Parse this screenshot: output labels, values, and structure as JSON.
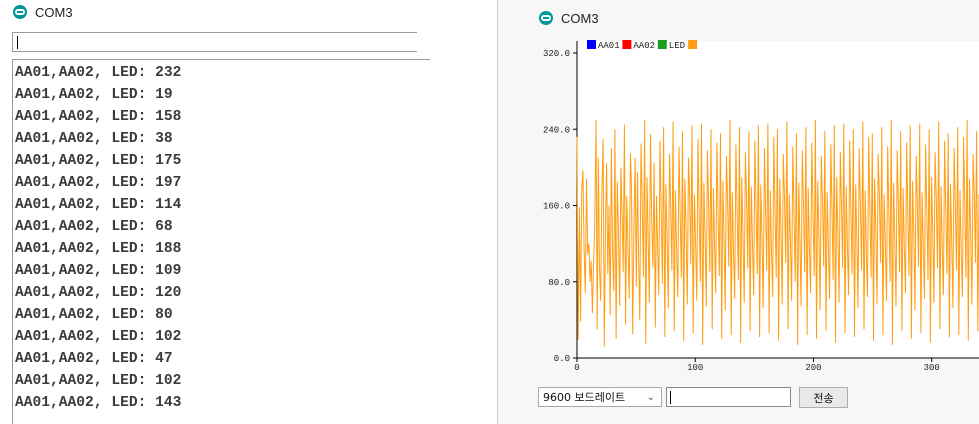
{
  "monitor": {
    "title": "COM3",
    "input_value": "",
    "lines": [
      "AA01,AA02, LED: 232",
      "AA01,AA02, LED: 19",
      "AA01,AA02, LED: 158",
      "AA01,AA02, LED: 38",
      "AA01,AA02, LED: 175",
      "AA01,AA02, LED: 197",
      "AA01,AA02, LED: 114",
      "AA01,AA02, LED: 68",
      "AA01,AA02, LED: 188",
      "AA01,AA02, LED: 109",
      "AA01,AA02, LED: 120",
      "AA01,AA02, LED: 80",
      "AA01,AA02, LED: 102",
      "AA01,AA02, LED: 47",
      "AA01,AA02, LED: 102",
      "AA01,AA02, LED: 143"
    ]
  },
  "plotter": {
    "title": "COM3",
    "baud_label": "9600 보드레이트",
    "input_value": "",
    "send_label": "전송",
    "icon_app": "arduino-icon",
    "icon_chevron": "chevron-down-icon"
  },
  "chart_data": {
    "type": "line",
    "ylim": [
      0,
      320
    ],
    "xlim": [
      0,
      340
    ],
    "y_ticks": [
      "0.0",
      "80.0",
      "160.0",
      "240.0",
      "320.0"
    ],
    "x_ticks": [
      "0",
      "100",
      "200",
      "300"
    ],
    "legend_placement": "top-left",
    "legend": [
      {
        "name": "AA01",
        "color": "#0000ff"
      },
      {
        "name": "AA02",
        "color": "#ff0000"
      },
      {
        "name": "LED",
        "color": "#1c9c1c"
      },
      {
        "name": "",
        "color": "#ff9e14"
      }
    ],
    "series": [
      {
        "name": "",
        "color": "#ff9e14",
        "values": [
          232,
          19,
          158,
          38,
          175,
          197,
          114,
          68,
          188,
          109,
          120,
          80,
          102,
          47,
          102,
          143,
          250,
          30,
          210,
          95,
          60,
          175,
          230,
          12,
          140,
          205,
          88,
          160,
          45,
          220,
          110,
          70,
          240,
          20,
          185,
          130,
          55,
          200,
          150,
          90,
          245,
          35,
          170,
          115,
          62,
          215,
          180,
          25,
          135,
          210,
          75,
          195,
          100,
          40,
          225,
          165,
          85,
          250,
          15,
          190,
          125,
          58,
          235,
          145,
          95,
          205,
          32,
          170,
          118,
          66,
          228,
          155,
          78,
          242,
          22,
          182,
          128,
          52,
          214,
          160,
          92,
          248,
          28,
          176,
          112,
          64,
          222,
          150,
          84,
          238,
          18,
          188,
          132,
          56,
          210,
          168,
          98,
          244,
          26,
          172,
          120,
          60,
          230,
          158,
          80,
          246,
          14,
          184,
          126,
          54,
          218,
          162,
          90,
          240,
          30,
          178,
          116,
          68,
          226,
          152,
          86,
          236,
          20,
          186,
          130,
          50,
          212,
          164,
          96,
          250,
          24,
          174,
          114,
          62,
          224,
          156,
          82,
          242,
          16,
          190,
          128,
          58,
          216,
          166,
          94,
          238,
          28,
          180,
          118,
          66,
          228,
          154,
          88,
          244,
          22,
          182,
          124,
          52,
          220,
          160,
          92,
          246,
          26,
          176,
          112,
          64,
          232,
          158,
          84,
          240,
          18,
          188,
          134,
          56,
          214,
          170,
          100,
          248,
          30,
          172,
          120,
          60,
          222,
          150,
          80,
          236,
          14,
          184,
          126,
          54,
          218,
          162,
          90,
          242,
          24,
          178,
          116,
          68,
          226,
          152,
          86,
          250,
          20,
          186,
          130,
          50,
          212,
          164,
          96,
          238,
          28,
          174,
          114,
          62,
          224,
          156,
          82,
          244,
          16,
          190,
          128,
          58,
          216,
          166,
          94,
          246,
          26,
          180,
          118,
          66,
          228,
          154,
          88,
          240,
          22,
          182,
          124,
          52,
          220,
          160,
          92,
          248,
          30,
          176,
          112,
          64,
          232,
          158,
          84,
          236,
          18,
          188,
          134,
          56,
          214,
          170,
          100,
          242,
          24,
          172,
          120,
          60,
          222,
          150,
          80,
          250,
          14,
          184,
          126,
          54,
          218,
          162,
          90,
          238,
          28,
          178,
          116,
          68,
          226,
          152,
          86,
          244,
          20,
          186,
          130,
          50,
          212,
          164,
          96,
          246,
          26,
          174,
          114,
          62,
          224,
          156,
          82,
          240,
          16,
          190,
          128,
          58,
          216,
          166,
          94,
          248,
          30,
          180,
          118,
          66,
          228,
          154,
          88,
          236,
          22,
          182,
          124,
          52,
          220,
          160,
          92,
          242,
          24,
          176,
          112,
          64,
          232,
          158,
          84,
          250,
          18,
          188,
          134,
          56,
          214,
          170,
          100,
          238,
          28,
          172
        ]
      }
    ]
  }
}
